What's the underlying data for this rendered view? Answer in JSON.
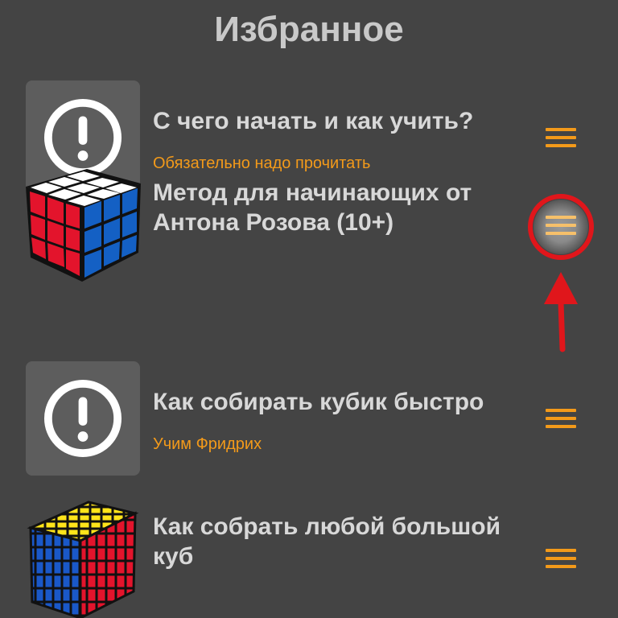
{
  "header": {
    "title": "Избранное"
  },
  "items": [
    {
      "title": "С чего начать и как учить?"
    },
    {
      "subtitle": "Обязательно надо прочитать",
      "title": "Метод для начинающих от Антона Розова (10+)"
    },
    {
      "title": "Как собирать кубик быстро",
      "subtitle": "Учим Фридрих"
    },
    {
      "title": "Как собрать любой большой куб"
    }
  ],
  "icons": {
    "alert": "exclamation-circle-icon",
    "menu": "menu-icon",
    "cube3": "rubiks-cube-3x3-icon",
    "cube6": "rubiks-cube-6x6-icon"
  },
  "colors": {
    "accent": "#f39a1a",
    "background": "#444444",
    "highlight": "#e0161b"
  }
}
